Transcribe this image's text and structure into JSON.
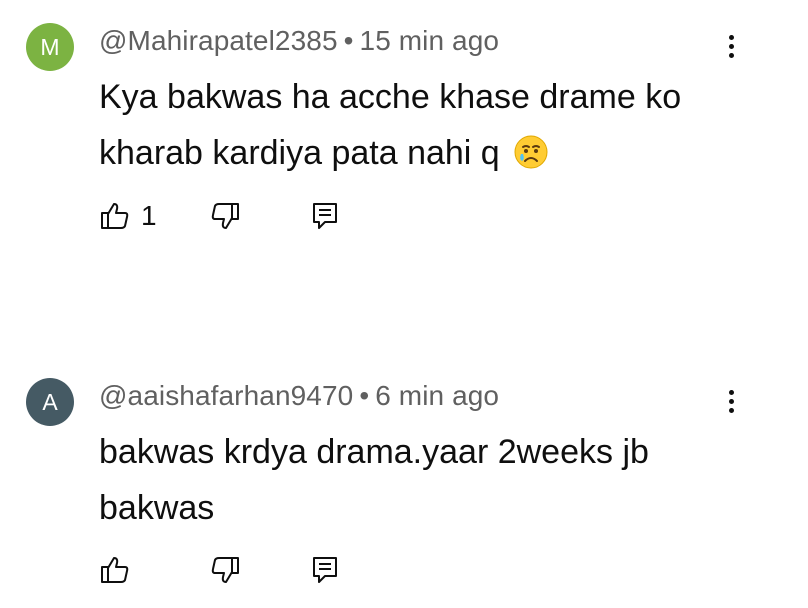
{
  "comments": [
    {
      "avatar_letter": "M",
      "avatar_color": "#7cb342",
      "handle": "@Mahirapatel2385",
      "separator": "•",
      "time": "15 min ago",
      "text": "Kya bakwas ha acche khase drame ko kharab kardiya pata nahi q",
      "emoji": "crying-face",
      "like_count": "1"
    },
    {
      "avatar_letter": "A",
      "avatar_color": "#455a64",
      "handle": "@aaishafarhan9470",
      "separator": "•",
      "time": "6 min ago",
      "text": "bakwas krdya drama.yaar 2weeks jb bakwas",
      "like_count": ""
    }
  ]
}
